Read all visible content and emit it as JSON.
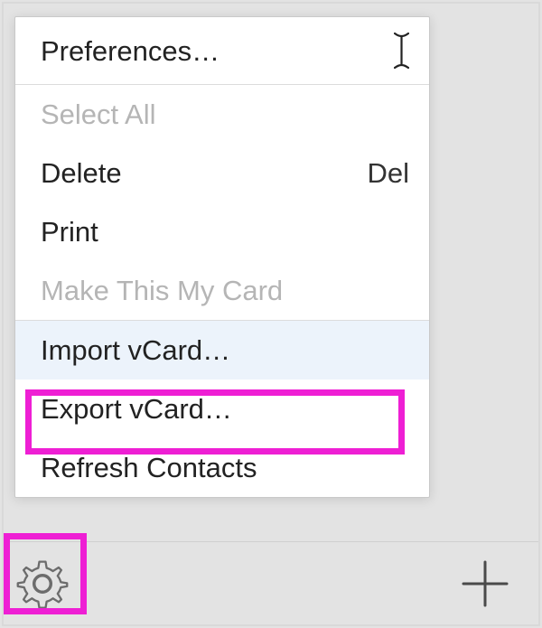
{
  "menu": {
    "items": [
      {
        "label": "Preferences…",
        "disabled": false,
        "shortcut": "",
        "has_caret": true,
        "highlighted": false
      },
      {
        "label": "Select All",
        "disabled": true,
        "shortcut": "",
        "has_caret": false,
        "highlighted": false
      },
      {
        "label": "Delete",
        "disabled": false,
        "shortcut": "Del",
        "has_caret": false,
        "highlighted": false
      },
      {
        "label": "Print",
        "disabled": false,
        "shortcut": "",
        "has_caret": false,
        "highlighted": false
      },
      {
        "label": "Make This My Card",
        "disabled": true,
        "shortcut": "",
        "has_caret": false,
        "highlighted": false
      },
      {
        "label": "Import vCard…",
        "disabled": false,
        "shortcut": "",
        "has_caret": false,
        "highlighted": true
      },
      {
        "label": "Export vCard…",
        "disabled": false,
        "shortcut": "",
        "has_caret": false,
        "highlighted": false
      },
      {
        "label": "Refresh Contacts",
        "disabled": false,
        "shortcut": "",
        "has_caret": false,
        "highlighted": false
      }
    ]
  },
  "callouts": {
    "export_color": "#ee1fd4",
    "gear_color": "#ee1fd4"
  },
  "toolbar": {
    "gear_label": "Settings",
    "add_label": "Add contact"
  }
}
